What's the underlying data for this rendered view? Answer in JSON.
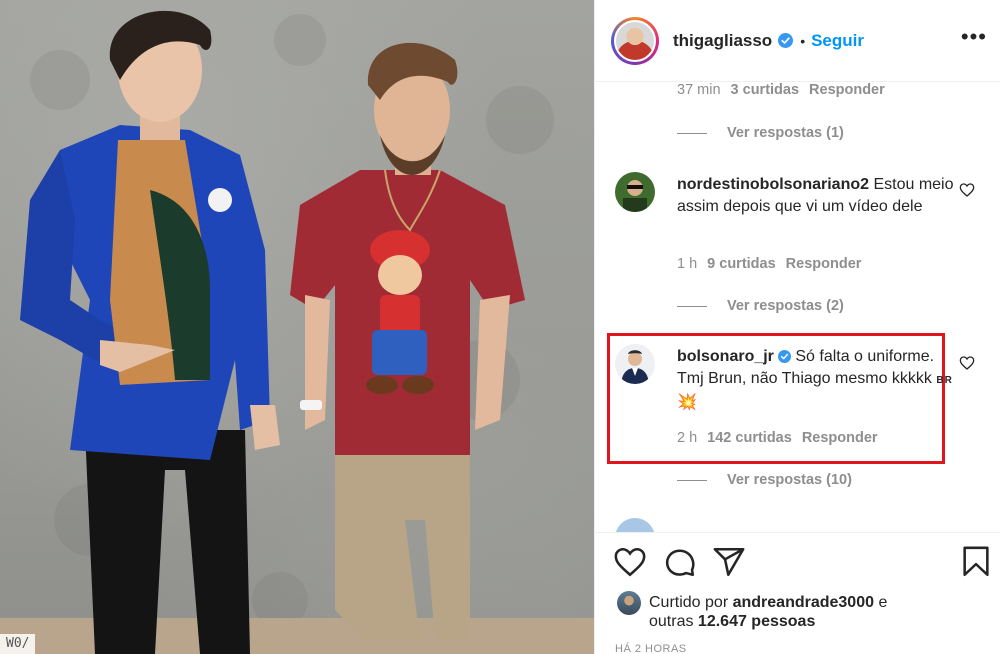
{
  "post": {
    "username": "thigagliasso",
    "follow_label": "Seguir",
    "separator": "•",
    "more_label": "•••"
  },
  "photo": {
    "watermark": "W0/"
  },
  "comments": {
    "top": {
      "time": "37 min",
      "likes": "3 curtidas",
      "reply": "Responder",
      "view_replies": "Ver respostas (1)"
    },
    "items": [
      {
        "username": "nordestinobolsonariano2",
        "text": " Estou meio assim depois que vi um vídeo dele",
        "time": "1 h",
        "likes": "9 curtidas",
        "reply": "Responder",
        "view_replies": "Ver respostas (2)"
      },
      {
        "username": "bolsonaro_jr",
        "text": " Só falta o uniforme. Tmj Brun, não Thiago mesmo kkkkk ",
        "flag_text": "BR",
        "emoji": "💥",
        "time": "2 h",
        "likes": "142 curtidas",
        "reply": "Responder",
        "view_replies": "Ver respostas (10)"
      }
    ]
  },
  "footer": {
    "liked_prefix": "Curtido por ",
    "liked_user": "andreandrade3000",
    "liked_and": " e",
    "others_prefix": "outras ",
    "others_count": "12.647 pessoas",
    "time_ago": "HÁ 2 HORAS"
  },
  "colors": {
    "accent": "#0095f6",
    "highlight": "#e0161c",
    "muted": "#8e8e8e",
    "text": "#262626"
  },
  "icons": [
    "heart-icon",
    "comment-icon",
    "share-icon",
    "bookmark-icon",
    "verified-icon",
    "more-icon"
  ]
}
